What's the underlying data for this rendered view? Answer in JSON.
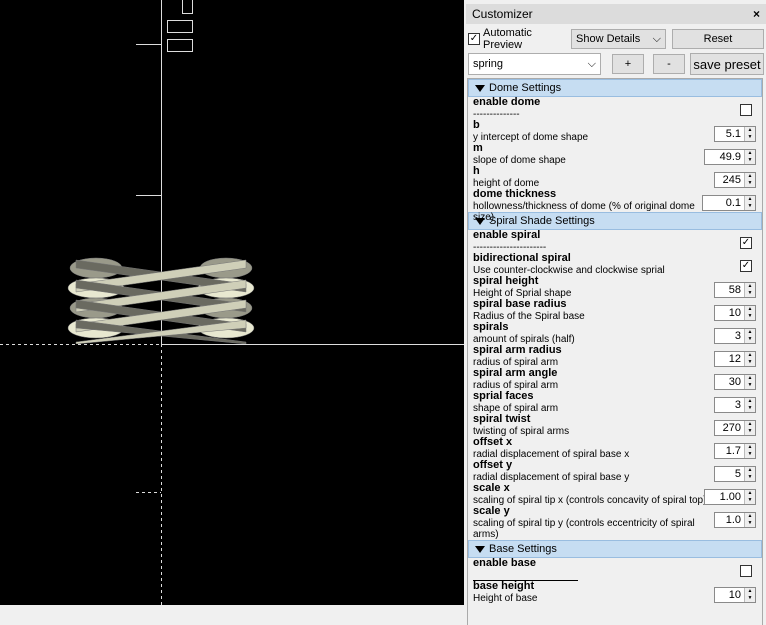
{
  "customizer": {
    "title": "Customizer",
    "close": "×",
    "auto_preview_label": "Automatic Preview",
    "auto_preview_checked": true,
    "details_select": "Show Details",
    "reset": "Reset",
    "preset": "spring",
    "plus": "+",
    "minus": "-",
    "save_preset": "save preset"
  },
  "sections": [
    {
      "title": "Dome Settings",
      "params": [
        {
          "name": "enable dome",
          "desc": "--------------",
          "type": "checkbox",
          "checked": false
        },
        {
          "name": "b",
          "desc": "y intercept of dome shape",
          "type": "spin",
          "value": "5.1"
        },
        {
          "name": "m",
          "desc": "slope of dome shape",
          "type": "spin",
          "value": "49.9"
        },
        {
          "name": "h",
          "desc": "height of dome",
          "type": "spin",
          "value": "245"
        },
        {
          "name": "dome thickness",
          "desc": "hollowness/thickness of dome (% of original dome size)",
          "type": "spin",
          "value": "0.1"
        }
      ]
    },
    {
      "title": "Spiral Shade Settings",
      "params": [
        {
          "name": "enable spiral",
          "desc": "----------------------",
          "type": "checkbox",
          "checked": true
        },
        {
          "name": "bidirectional spiral",
          "desc": "Use counter-clockwise and clockwise sprial",
          "type": "checkbox",
          "checked": true
        },
        {
          "name": "spiral height",
          "desc": "Height of Sprial shape",
          "type": "spin",
          "value": "58"
        },
        {
          "name": "spiral base radius",
          "desc": "Radius of the Spiral base",
          "type": "spin",
          "value": "10"
        },
        {
          "name": "spirals",
          "desc": "amount of spirals (half)",
          "type": "spin",
          "value": "3"
        },
        {
          "name": "spiral arm radius",
          "desc": "radius of spiral arm",
          "type": "spin",
          "value": "12"
        },
        {
          "name": "spiral arm angle",
          "desc": "radius of spiral arm",
          "type": "spin",
          "value": "30"
        },
        {
          "name": "sprial faces",
          "desc": "shape of spiral arm",
          "type": "spin",
          "value": "3"
        },
        {
          "name": "spiral twist",
          "desc": "twisting of spiral arms",
          "type": "spin",
          "value": "270"
        },
        {
          "name": "offset x",
          "desc": "radial displacement of spiral base x",
          "type": "spin",
          "value": "1.7"
        },
        {
          "name": "offset y",
          "desc": "radial displacement of spiral base y",
          "type": "spin",
          "value": "5"
        },
        {
          "name": "scale x",
          "desc": "scaling of spiral tip x (controls concavity of spiral top)",
          "type": "spin",
          "value": "1.00"
        },
        {
          "name": "scale y",
          "desc": "scaling of spiral tip y (controls eccentricity of spiral arms)",
          "type": "spin",
          "value": "1.0"
        }
      ]
    },
    {
      "title": "Base Settings",
      "params": [
        {
          "name": "enable base",
          "desc": "",
          "type": "checkbox",
          "checked": false
        },
        {
          "name": "base height",
          "desc": "Height of base",
          "type": "spin",
          "value": "10"
        }
      ]
    }
  ]
}
